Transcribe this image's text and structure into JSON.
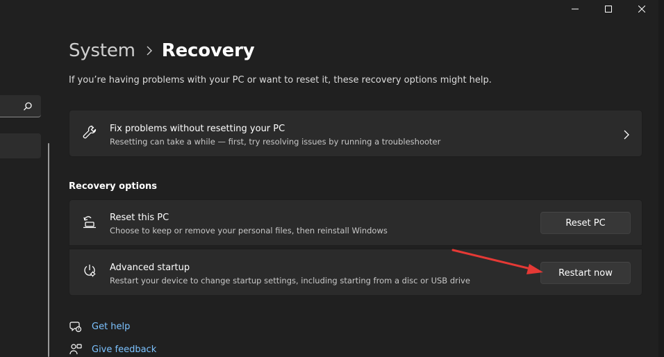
{
  "breadcrumb": {
    "parent": "System",
    "current": "Recovery"
  },
  "subtitle": "If you’re having problems with your PC or want to reset it, these recovery options might help.",
  "fix_card": {
    "title": "Fix problems without resetting your PC",
    "description": "Resetting can take a while — first, try resolving issues by running a troubleshooter",
    "icon": "wrench-icon"
  },
  "recovery_options": {
    "heading": "Recovery options",
    "reset": {
      "title": "Reset this PC",
      "description": "Choose to keep or remove your personal files, then reinstall Windows",
      "button_label": "Reset PC",
      "icon": "reset-pc-icon"
    },
    "advanced": {
      "title": "Advanced startup",
      "description": "Restart your device to change startup settings, including starting from a disc or USB drive",
      "button_label": "Restart now",
      "icon": "advanced-startup-icon"
    }
  },
  "links": {
    "help": "Get help",
    "feedback": "Give feedback"
  },
  "colors": {
    "background": "#202020",
    "card": "#2b2b2b",
    "button": "#373737",
    "link": "#7cc2ff",
    "annotation_arrow": "#e53935"
  }
}
